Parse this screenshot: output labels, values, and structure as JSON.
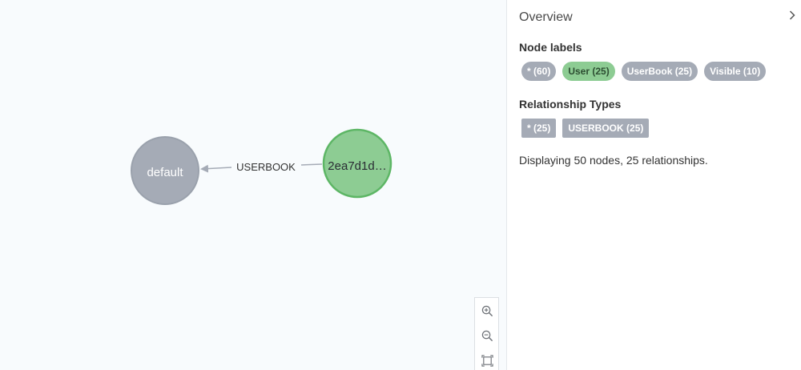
{
  "graph": {
    "nodes": [
      {
        "label": "default",
        "color": "#a5abb6",
        "border": "#9aa1ac",
        "text_color": "#ffffff"
      },
      {
        "label": "2ea7d1d…",
        "color": "#8dcc93",
        "border": "#5db665",
        "text_color": "#2a2c34"
      }
    ],
    "relationship": {
      "label": "USERBOOK",
      "color": "#a5abb6"
    }
  },
  "sidebar": {
    "title": "Overview",
    "node_labels_title": "Node labels",
    "node_labels": [
      {
        "label": "* (60)",
        "color": "#a5abb6"
      },
      {
        "label": "User (25)",
        "color": "#8dcc93"
      },
      {
        "label": "UserBook (25)",
        "color": "#a5abb6"
      },
      {
        "label": "Visible (10)",
        "color": "#a5abb6"
      }
    ],
    "rel_types_title": "Relationship Types",
    "rel_types": [
      {
        "label": "* (25)"
      },
      {
        "label": "USERBOOK (25)"
      }
    ],
    "summary": "Displaying 50 nodes, 25 relationships."
  },
  "icons": {
    "zoom_in": "zoom-in-icon",
    "zoom_out": "zoom-out-icon",
    "fit": "fit-to-screen-icon",
    "collapse": "chevron-right-icon"
  }
}
